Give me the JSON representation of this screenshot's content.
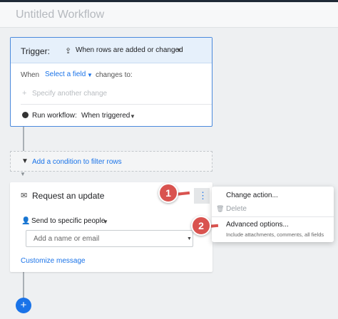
{
  "header": {
    "title": "Untitled Workflow"
  },
  "trigger": {
    "label": "Trigger:",
    "event": "When rows are added or changed",
    "when_label": "When",
    "field_select": "Select a field",
    "changes_to": "changes to:",
    "specify_placeholder": "Specify another change",
    "run_label": "Run workflow:",
    "run_value": "When triggered"
  },
  "filter": {
    "label": "Add a condition to filter rows"
  },
  "action": {
    "title": "Request an update",
    "send_to": "Send to specific people",
    "name_placeholder": "Add a name or email",
    "customize": "Customize message"
  },
  "menu": {
    "change_action": "Change action...",
    "delete": "Delete",
    "advanced": "Advanced options...",
    "advanced_sub": "Include attachments, comments, all fields"
  },
  "callouts": {
    "one": "1",
    "two": "2"
  },
  "add_button": {
    "label": "+"
  },
  "colors": {
    "accent": "#1a73e8",
    "trigger_border": "#4a89dc",
    "trigger_header": "#e6f0fb",
    "callout": "#d9534f"
  },
  "icons": [
    "upload-icon",
    "caret-down-icon",
    "plus-icon",
    "clock-icon",
    "filter-icon",
    "arrow-down-icon",
    "request-update-icon",
    "more-vert-icon",
    "add-person-icon",
    "trash-icon",
    "add-icon"
  ]
}
